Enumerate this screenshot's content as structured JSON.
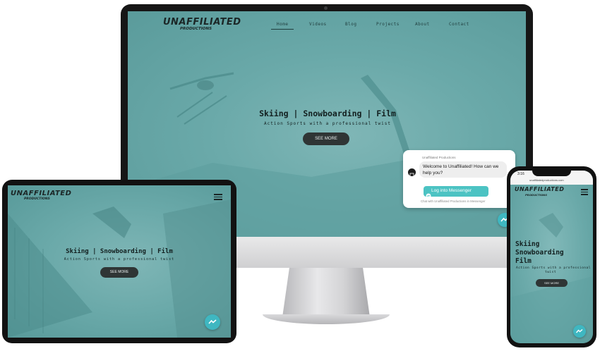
{
  "brand": {
    "logo_main": "UNAFFILIATED",
    "logo_sub": "PRODUCTIONS"
  },
  "nav": {
    "items": [
      "Home",
      "Videos",
      "Blog",
      "Projects",
      "About",
      "Contact"
    ],
    "active": "Home"
  },
  "hero": {
    "title": "Skiing | Snowboarding | Film",
    "subtitle": "Action Sports with a professional twist",
    "cta": "SEE MORE"
  },
  "phone_hero": {
    "line1": "Skiing",
    "line2": "Snowboarding",
    "line3": "Film",
    "subtitle_line1": "Action Sports with a professional",
    "subtitle_line2": "twist"
  },
  "chat": {
    "brand": "Unaffiliated Productions",
    "message": "Welcome to Unaffiliated! How can we help you?",
    "button": "Log into Messenger",
    "footer": "Chat with Unaffiliated Productions in Messenger"
  },
  "phone": {
    "time": "3:16",
    "url": "unaffiliatedproductions.com"
  },
  "colors": {
    "hero_teal": "#6aa9a9",
    "accent_cyan": "#4cc3c3",
    "dark": "#2f3535"
  }
}
